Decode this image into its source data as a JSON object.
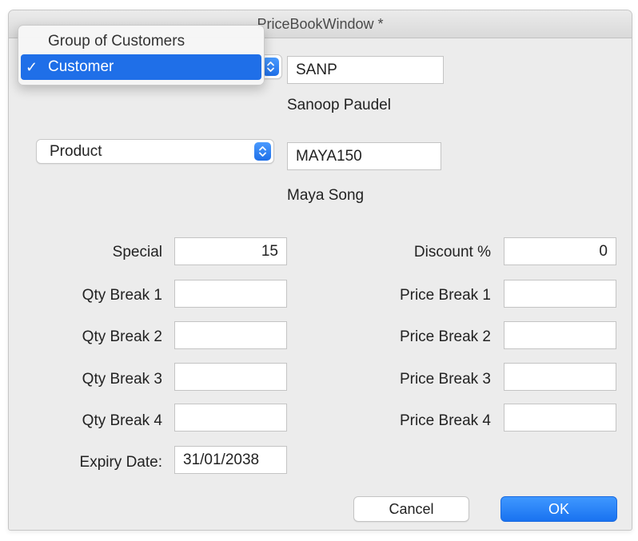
{
  "window": {
    "title": "PriceBookWindow *"
  },
  "customer_selector": {
    "popup_options": [
      {
        "label": "Group of Customers",
        "selected": false
      },
      {
        "label": "Customer",
        "selected": true
      }
    ],
    "code": "SANP",
    "name": "Sanoop Paudel"
  },
  "product_selector": {
    "selected": "Product",
    "code": "MAYA150",
    "name": "Maya Song"
  },
  "pricing": {
    "special_label": "Special",
    "special_value": "15",
    "discount_label": "Discount %",
    "discount_value": "0",
    "qty_breaks": [
      {
        "label": "Qty Break 1",
        "value": ""
      },
      {
        "label": "Qty Break 2",
        "value": ""
      },
      {
        "label": "Qty Break 3",
        "value": ""
      },
      {
        "label": "Qty Break 4",
        "value": ""
      }
    ],
    "price_breaks": [
      {
        "label": "Price Break 1",
        "value": ""
      },
      {
        "label": "Price Break 2",
        "value": ""
      },
      {
        "label": "Price Break 3",
        "value": ""
      },
      {
        "label": "Price Break 4",
        "value": ""
      }
    ],
    "expiry_label": "Expiry Date:",
    "expiry_value": "31/01/2038"
  },
  "buttons": {
    "cancel": "Cancel",
    "ok": "OK"
  },
  "icons": {
    "check": "checkmark-icon",
    "stepper": "up-down-chevron-icon"
  },
  "colors": {
    "accent": "#1f6fe8",
    "window_bg": "#ececec"
  }
}
